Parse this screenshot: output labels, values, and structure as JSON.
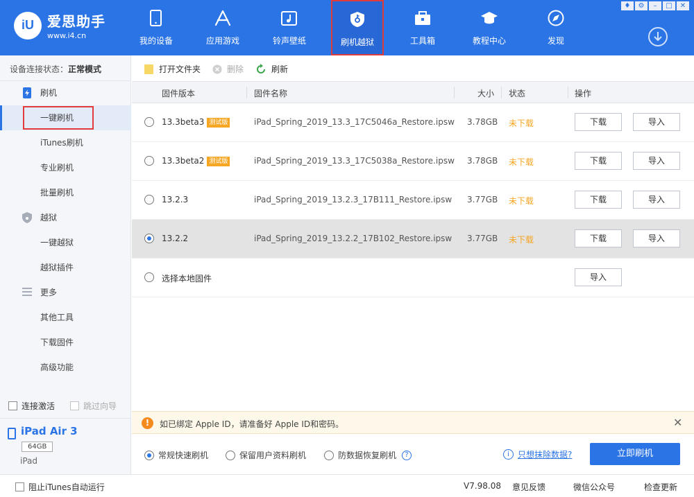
{
  "app": {
    "logo_badge": "iU",
    "name": "爱思助手",
    "url": "www.i4.cn",
    "accent_color": "#2b74e6"
  },
  "nav": [
    {
      "label": "我的设备",
      "icon": "phone-icon"
    },
    {
      "label": "应用游戏",
      "icon": "app-store-icon"
    },
    {
      "label": "铃声壁纸",
      "icon": "music-picture-icon"
    },
    {
      "label": "刷机越狱",
      "icon": "shield-key-icon",
      "active": true
    },
    {
      "label": "工具箱",
      "icon": "toolbox-icon"
    },
    {
      "label": "教程中心",
      "icon": "graduation-cap-icon"
    },
    {
      "label": "发现",
      "icon": "compass-icon"
    }
  ],
  "sidebar": {
    "status_label": "设备连接状态：",
    "status_value": "正常模式",
    "groups": [
      {
        "label": "刷机",
        "icon": "flash-icon",
        "items": [
          "一键刷机",
          "iTunes刷机",
          "专业刷机",
          "批量刷机"
        ]
      },
      {
        "label": "越狱",
        "icon": "jailbreak-shield-icon",
        "items": [
          "一键越狱",
          "越狱插件"
        ]
      },
      {
        "label": "更多",
        "icon": "menu-lines-icon",
        "items": [
          "其他工具",
          "下载固件",
          "高级功能"
        ]
      }
    ],
    "selected_item": "一键刷机",
    "auto_activate": "连接激活",
    "skip_guide": "跳过向导",
    "device": {
      "name": "iPad Air 3",
      "capacity": "64GB",
      "type": "iPad"
    }
  },
  "toolbar": {
    "open_folder": "打开文件夹",
    "delete": "删除",
    "refresh": "刷新"
  },
  "table": {
    "headers": [
      "固件版本",
      "固件名称",
      "大小",
      "状态",
      "操作"
    ],
    "download_label": "下载",
    "import_label": "导入",
    "rows": [
      {
        "version": "13.3beta3",
        "tag": "测试版",
        "file": "iPad_Spring_2019_13.3_17C5046a_Restore.ipsw",
        "size": "3.78GB",
        "status": "未下载"
      },
      {
        "version": "13.3beta2",
        "tag": "测试版",
        "file": "iPad_Spring_2019_13.3_17C5038a_Restore.ipsw",
        "size": "3.78GB",
        "status": "未下载"
      },
      {
        "version": "13.2.3",
        "tag": "",
        "file": "iPad_Spring_2019_13.2.3_17B111_Restore.ipsw",
        "size": "3.77GB",
        "status": "未下载"
      },
      {
        "version": "13.2.2",
        "tag": "",
        "file": "iPad_Spring_2019_13.2.2_17B102_Restore.ipsw",
        "size": "3.77GB",
        "status": "未下载",
        "selected": true
      }
    ],
    "local_firmware": "选择本地固件"
  },
  "alert": {
    "text": "如已绑定 Apple ID，请准备好 Apple ID和密码。"
  },
  "modes": {
    "quick": "常规快速刷机",
    "keep_data": "保留用户资料刷机",
    "anti_recovery": "防数据恢复刷机",
    "help": "?",
    "erase_link": "只想抹除数据?",
    "flash_button": "立即刷机"
  },
  "statusbar": {
    "block_itunes": "阻止iTunes自动运行",
    "version": "V7.98.08",
    "feedback": "意见反馈",
    "wechat": "微信公众号",
    "check_update": "检查更新"
  }
}
